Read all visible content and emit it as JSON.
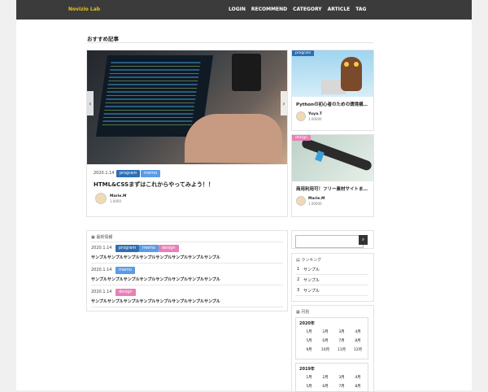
{
  "site": {
    "logo": "Novizio Lab"
  },
  "nav": [
    "LOGIN",
    "RECOMMEND",
    "CATEGORY",
    "ARTICLE",
    "TAG"
  ],
  "recommend": {
    "title": "おすすめ記事",
    "featured": {
      "date": "2020.1.14",
      "tags": [
        "program",
        "memo"
      ],
      "title": "HTML&CSSまずはこれからやってみよう！！",
      "author": "Marie.M",
      "likes": "1.0000"
    },
    "side": [
      {
        "category": "program",
        "title": "Pythonの初心者のための環境構…",
        "author": "Yuya.T",
        "likes": "1.00000"
      },
      {
        "category": "design",
        "title": "商用利用可！フリー素材サイトま…",
        "author": "Marie.M",
        "likes": "1.00000"
      }
    ]
  },
  "news": {
    "title": "最新情報",
    "items": [
      {
        "date": "2020.1.14",
        "tags": [
          "program",
          "memo",
          "design"
        ],
        "text": "サンプルサンプルサンプルサンプルサンプルサンプルサンプルサンプル"
      },
      {
        "date": "2020.1.14",
        "tags": [
          "memo"
        ],
        "text": "サンプルサンプルサンプルサンプルサンプルサンプルサンプルサンプル"
      },
      {
        "date": "2020.1.14",
        "tags": [
          "design"
        ],
        "text": "サンプルサンプルサンプルサンプルサンプルサンプルサンプルサンプル"
      }
    ]
  },
  "search": {
    "placeholder": ""
  },
  "ranking": {
    "title": "ランキング",
    "items": [
      {
        "num": "1",
        "label": "サンプル"
      },
      {
        "num": "2",
        "label": "サンプル"
      },
      {
        "num": "3",
        "label": "サンプル"
      }
    ]
  },
  "archive": {
    "title": "月別",
    "years": [
      {
        "year": "2020年",
        "months": [
          "1月",
          "2月",
          "3月",
          "4月",
          "5月",
          "6月",
          "7月",
          "8月",
          "9月",
          "10月",
          "11月",
          "12月"
        ]
      },
      {
        "year": "2019年",
        "months": [
          "1月",
          "2月",
          "3月",
          "4月",
          "5月",
          "6月",
          "7月",
          "8月"
        ]
      }
    ]
  },
  "icons": {
    "prev": "chevron-left-icon",
    "next": "chevron-right-icon",
    "search": "search-icon",
    "news": "news-icon",
    "ranking": "chart-icon",
    "calendar": "calendar-icon"
  },
  "colors": {
    "header": "#3b3b3b",
    "logo": "#e9c21d",
    "program": "#2f6fb4",
    "memo": "#5c9be6",
    "design": "#e97fb8"
  }
}
